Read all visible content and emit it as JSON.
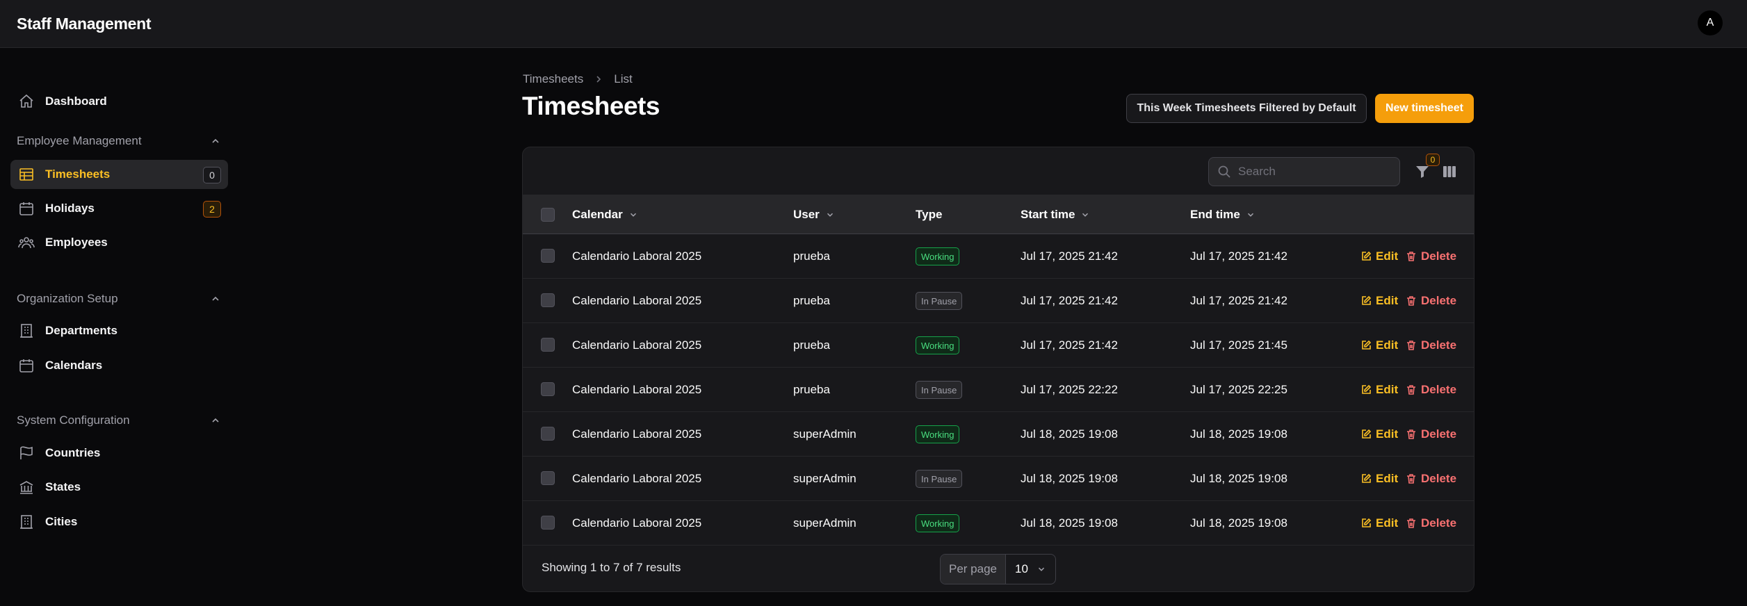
{
  "app": {
    "title": "Staff Management",
    "avatar_initial": "A"
  },
  "sidebar": {
    "dashboard": {
      "label": "Dashboard",
      "icon": "home-icon"
    },
    "groups": [
      {
        "label": "Employee Management",
        "items": [
          {
            "label": "Timesheets",
            "icon": "table-icon",
            "badge": "0",
            "active": true
          },
          {
            "label": "Holidays",
            "icon": "calendar-icon",
            "badge": "2"
          },
          {
            "label": "Employees",
            "icon": "users-icon"
          }
        ]
      },
      {
        "label": "Organization Setup",
        "items": [
          {
            "label": "Departments",
            "icon": "building-icon"
          },
          {
            "label": "Calendars",
            "icon": "calendar-icon"
          }
        ]
      },
      {
        "label": "System Configuration",
        "items": [
          {
            "label": "Countries",
            "icon": "flag-icon"
          },
          {
            "label": "States",
            "icon": "bank-icon"
          },
          {
            "label": "Cities",
            "icon": "building-icon"
          }
        ]
      }
    ]
  },
  "breadcrumb": {
    "parent": "Timesheets",
    "current": "List"
  },
  "page": {
    "title": "Timesheets",
    "filter_button": "This Week Timesheets Filtered by Default",
    "new_button": "New timesheet"
  },
  "table": {
    "search_placeholder": "Search",
    "filter_count": "0",
    "columns": {
      "calendar": "Calendar",
      "user": "User",
      "type": "Type",
      "start": "Start time",
      "end": "End time"
    },
    "rows": [
      {
        "calendar": "Calendario Laboral 2025",
        "user": "prueba",
        "type": "Working",
        "start": "Jul 17, 2025 21:42",
        "end": "Jul 17, 2025 21:42"
      },
      {
        "calendar": "Calendario Laboral 2025",
        "user": "prueba",
        "type": "In Pause",
        "start": "Jul 17, 2025 21:42",
        "end": "Jul 17, 2025 21:42"
      },
      {
        "calendar": "Calendario Laboral 2025",
        "user": "prueba",
        "type": "Working",
        "start": "Jul 17, 2025 21:42",
        "end": "Jul 17, 2025 21:45"
      },
      {
        "calendar": "Calendario Laboral 2025",
        "user": "prueba",
        "type": "In Pause",
        "start": "Jul 17, 2025 22:22",
        "end": "Jul 17, 2025 22:25"
      },
      {
        "calendar": "Calendario Laboral 2025",
        "user": "superAdmin",
        "type": "Working",
        "start": "Jul 18, 2025 19:08",
        "end": "Jul 18, 2025 19:08"
      },
      {
        "calendar": "Calendario Laboral 2025",
        "user": "superAdmin",
        "type": "In Pause",
        "start": "Jul 18, 2025 19:08",
        "end": "Jul 18, 2025 19:08"
      },
      {
        "calendar": "Calendario Laboral 2025",
        "user": "superAdmin",
        "type": "Working",
        "start": "Jul 18, 2025 19:08",
        "end": "Jul 18, 2025 19:08"
      }
    ],
    "edit_label": "Edit",
    "delete_label": "Delete",
    "footer_text": "Showing 1 to 7 of 7 results",
    "per_page_label": "Per page",
    "per_page_value": "10"
  },
  "colors": {
    "accent": "#f59e0b",
    "danger": "#f87171",
    "success": "#4ade80"
  }
}
